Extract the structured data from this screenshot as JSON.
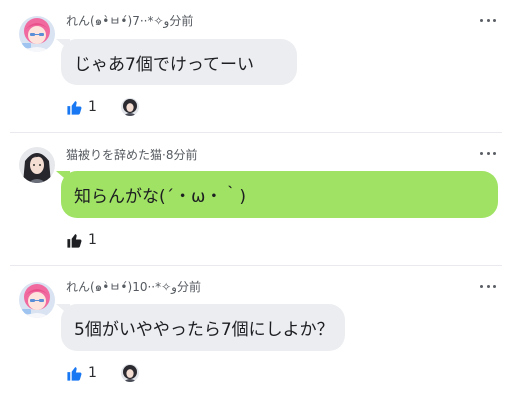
{
  "comments": [
    {
      "author": "れん(๑•̀ㅂ•́)و✧*·",
      "time": "7分前",
      "separator": "·",
      "text": "じゃあ7個でけってーい",
      "like_count": "1",
      "bubble": "gray",
      "like_active": true,
      "avatar": "pink-hair-avatar",
      "has_reactor": true
    },
    {
      "author": "猫被りを辞めた猫",
      "time": "8分前",
      "separator": "·",
      "text": "知らんがな(´・ω・｀)",
      "like_count": "1",
      "bubble": "green",
      "like_active": false,
      "avatar": "dark-hair-avatar",
      "has_reactor": false
    },
    {
      "author": "れん(๑•̀ㅂ•́)و✧*·",
      "time": "10分前",
      "separator": "·",
      "text": "5個がいややったら7個にしよか？",
      "like_count": "1",
      "bubble": "gray",
      "like_active": true,
      "avatar": "pink-hair-avatar",
      "has_reactor": true
    }
  ],
  "colors": {
    "like_active": "#1877f2",
    "like_inactive": "#1c1e21",
    "bubble_gray": "#ebedf0",
    "bubble_green": "#a0e264"
  }
}
